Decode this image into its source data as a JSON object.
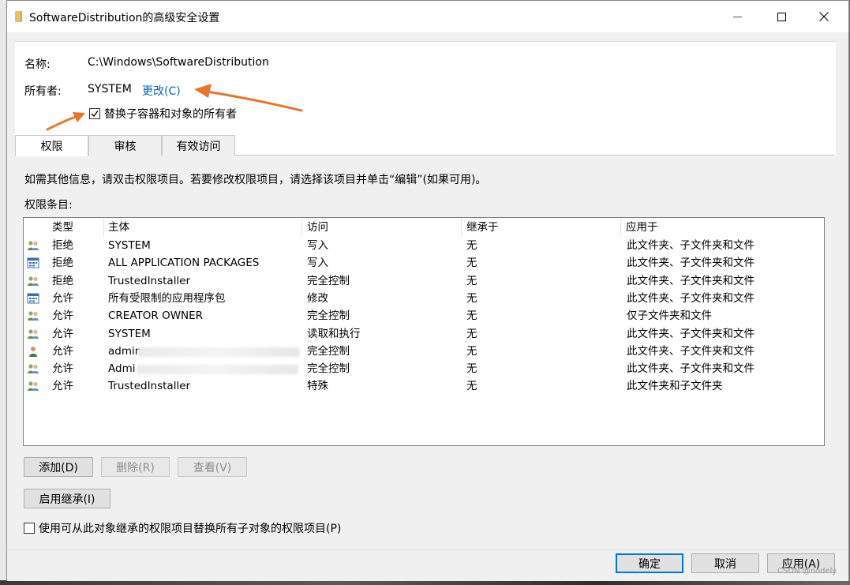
{
  "window": {
    "title": "SoftwareDistribution的高级安全设置",
    "icon": "folder-icon"
  },
  "header": {
    "name_label": "名称:",
    "name_value": "C:\\Windows\\SoftwareDistribution",
    "owner_label": "所有者:",
    "owner_value": "SYSTEM",
    "change_link": "更改(C)",
    "replace_owner_checkbox": {
      "label": "替换子容器和对象的所有者",
      "checked": true
    }
  },
  "tabs": [
    {
      "label": "权限",
      "active": true
    },
    {
      "label": "审核",
      "active": false
    },
    {
      "label": "有效访问",
      "active": false
    }
  ],
  "permissions": {
    "info_text": "如需其他信息，请双击权限项目。若要修改权限项目，请选择该项目并单击“编辑”(如果可用)。",
    "entries_label": "权限条目:",
    "columns": [
      "类型",
      "主体",
      "访问",
      "继承于",
      "应用于"
    ],
    "rows": [
      {
        "icon": "group-icon",
        "type": "拒绝",
        "principal": "SYSTEM",
        "principal_blurred": false,
        "access": "写入",
        "inherited": "无",
        "applies": "此文件夹、子文件夹和文件"
      },
      {
        "icon": "package-icon",
        "type": "拒绝",
        "principal": "ALL APPLICATION PACKAGES",
        "principal_blurred": false,
        "access": "写入",
        "inherited": "无",
        "applies": "此文件夹、子文件夹和文件"
      },
      {
        "icon": "group-icon",
        "type": "拒绝",
        "principal": "TrustedInstaller",
        "principal_blurred": false,
        "access": "完全控制",
        "inherited": "无",
        "applies": "此文件夹、子文件夹和文件"
      },
      {
        "icon": "package-icon",
        "type": "允许",
        "principal": "所有受限制的应用程序包",
        "principal_blurred": false,
        "access": "修改",
        "inherited": "无",
        "applies": "此文件夹、子文件夹和文件"
      },
      {
        "icon": "group-icon",
        "type": "允许",
        "principal": "CREATOR OWNER",
        "principal_blurred": false,
        "access": "完全控制",
        "inherited": "无",
        "applies": "仅子文件夹和文件"
      },
      {
        "icon": "group-icon",
        "type": "允许",
        "principal": "SYSTEM",
        "principal_blurred": false,
        "access": "读取和执行",
        "inherited": "无",
        "applies": "此文件夹、子文件夹和文件"
      },
      {
        "icon": "user-icon",
        "type": "允许",
        "principal": "admin",
        "principal_blurred": true,
        "access": "完全控制",
        "inherited": "无",
        "applies": "此文件夹、子文件夹和文件"
      },
      {
        "icon": "group-icon",
        "type": "允许",
        "principal": "Admi",
        "principal_blurred": true,
        "access": "完全控制",
        "inherited": "无",
        "applies": "此文件夹、子文件夹和文件"
      },
      {
        "icon": "group-icon",
        "type": "允许",
        "principal": "TrustedInstaller",
        "principal_blurred": false,
        "access": "特殊",
        "inherited": "无",
        "applies": "此文件夹和子文件夹"
      }
    ]
  },
  "buttons": {
    "add": "添加(D)",
    "remove": "删除(R)",
    "view": "查看(V)",
    "enable_inheritance": "启用继承(I)",
    "ok": "确定",
    "cancel": "取消",
    "apply": "应用(A)"
  },
  "replace_children_checkbox": {
    "label": "使用可从此对象继承的权限项目替换所有子对象的权限项目(P)",
    "checked": false
  },
  "watermark": "CSDN @nodely",
  "colors": {
    "link": "#0066cc",
    "annotation_arrow": "#e8762c",
    "focus_border": "#0078d7"
  }
}
